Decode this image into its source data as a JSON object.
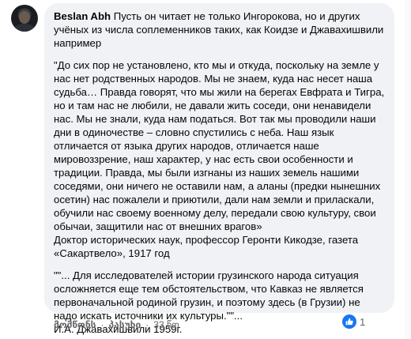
{
  "comment": {
    "author": "Beslan Abh",
    "intro": " Пусть он читает не только Ингорокова, но и других учёных из числа соплеменников таких, как Коидзе и Джавахишвили например",
    "quote1": "\"До сих пор не установлено, кто мы и откуда, поскольку на земле у нас нет родственных народов. Мы не знаем, куда нас несет наша судьба… Правда говорят, что мы жили на берегах Евфрата и Тигра, но и там нас не любили, не давали жить соседи, они ненавидели нас. Мы не знали, куда нам податься. Вот так мы проводили наши дни в одиночестве – словно спустились с неба. Наш язык отличается от языка других народов, отличается наше мировоззрение, наш характер, у нас есть свои особенности и традиции. Правда, мы были изгнаны из наших земель нашими соседями, они ничего не оставили нам, а аланы (предки нынешних осетин) нас пожалели и приютили, дали нам земли и приласкали, обучили нас своему военному делу, передали свою культуру, свои обычаи, защитили нас от внешних врагов»",
    "quote1_source": "Доктор исторических наук, профессор Геронти Кикодзе, газета «Сакартвело», 1917 год",
    "quote2": "\"\"... Для исследователей истории грузинского народа ситуация осложняется еще тем обстоятельством, что Кавказ не является первоначальной родиной грузин, и поэтому здесь (в Грузии) не надо искать источники их культуры.\"\"...",
    "quote2_source": "И.А. Джавахишвили 1959г.",
    "reaction_count": "1"
  },
  "actions": {
    "like": "მომწონს",
    "reply": "პასუხი",
    "separator": "·",
    "time": "33 წთ"
  },
  "colors": {
    "bubble": "#f0f2f5",
    "like_blue": "#1877f2",
    "meta_gray": "#65676b"
  }
}
